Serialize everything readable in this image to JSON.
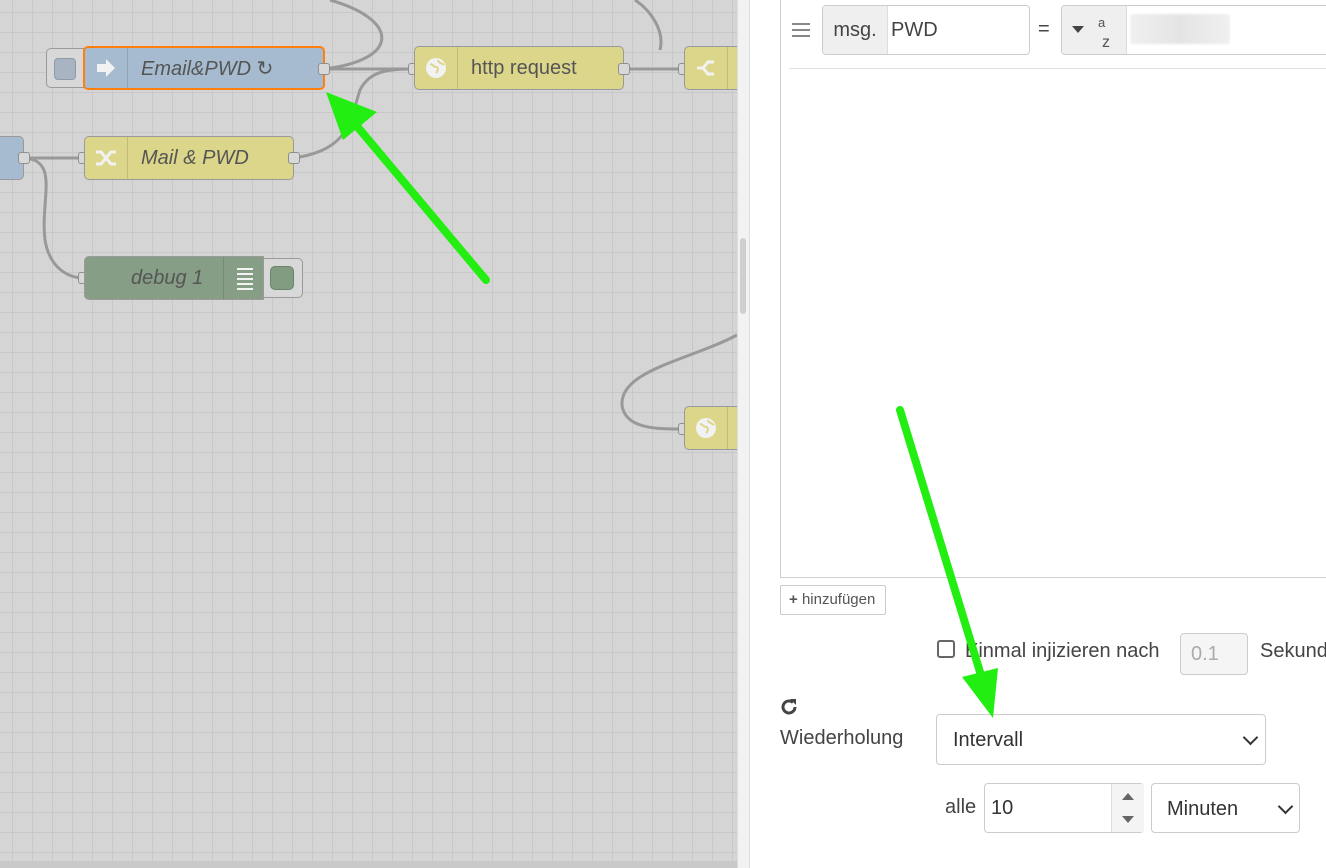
{
  "canvas": {
    "nodes": {
      "inject_label": "Email&PWD ↻",
      "http_label": "http request",
      "change_label": "Mail & PWD",
      "debug_label": "debug 1"
    }
  },
  "editor": {
    "property": {
      "prefix": "msg.",
      "name": "PWD",
      "equals": "=",
      "type_icon": "az-string-icon"
    },
    "add_button_label": "hinzufügen",
    "inject_once": {
      "label": "Einmal injizieren nach",
      "value": "0.1",
      "unit": "Sekunden"
    },
    "repeat": {
      "label": "Wiederholung",
      "selected": "Intervall"
    },
    "interval": {
      "label": "alle",
      "value": "10",
      "unit": "Minuten"
    }
  },
  "colors": {
    "canvas_bg": "#d5d5d5",
    "inject_node": "#a6bbcf",
    "function_node": "#dcd68b",
    "debug_node": "#879e86",
    "selection_outline": "#ff7f0e",
    "annotation_arrow": "#22ee11"
  }
}
